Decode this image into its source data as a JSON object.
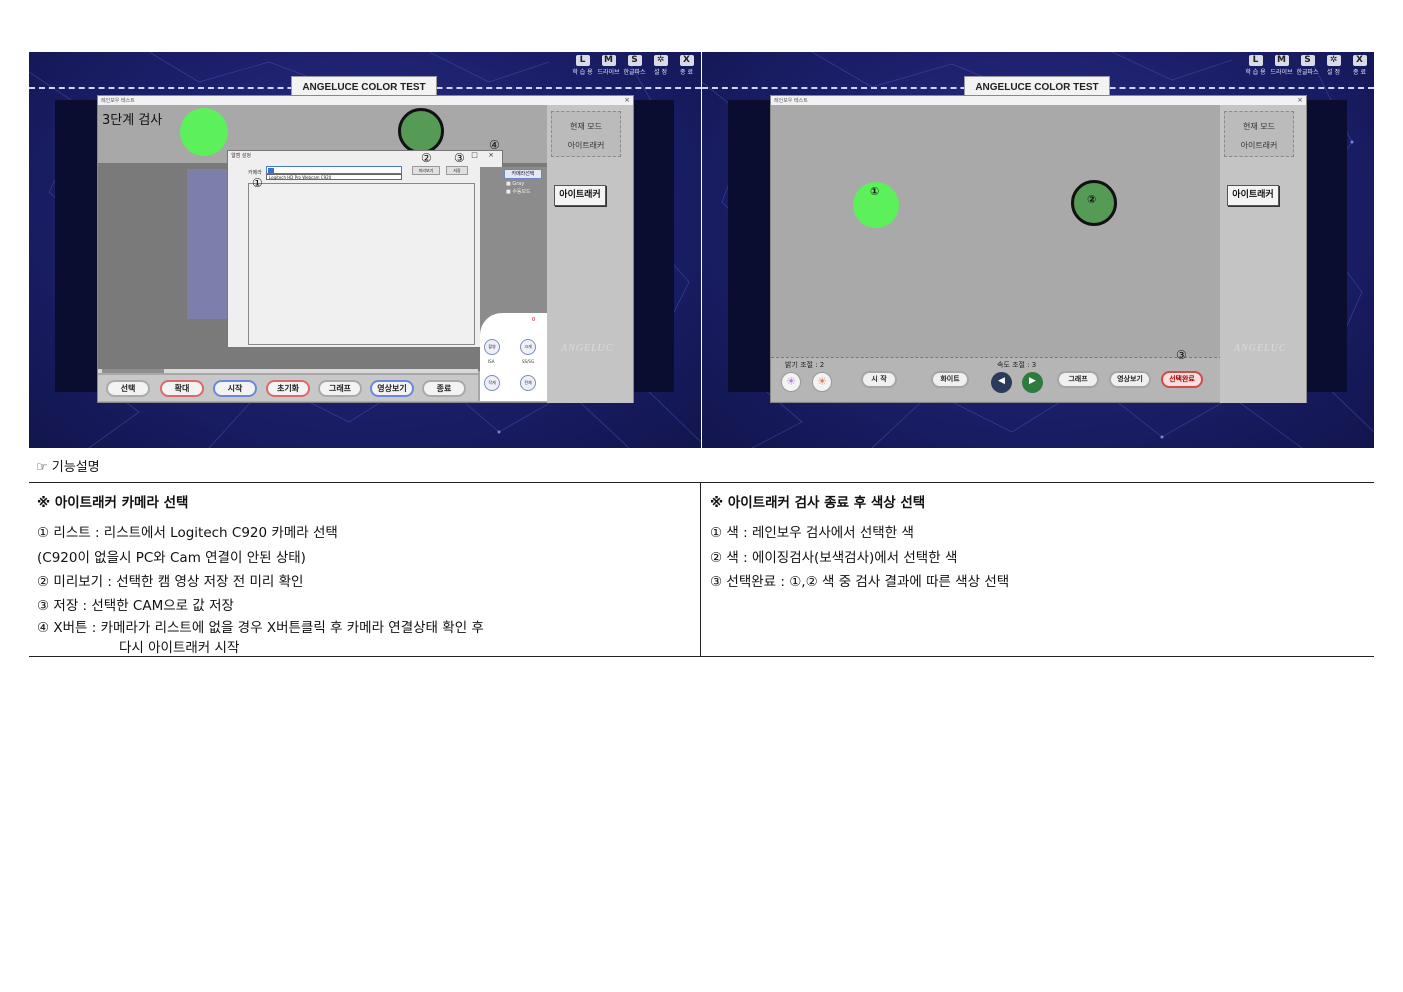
{
  "left_shot": {
    "app_title": "ANGELUCE COLOR TEST",
    "top_icons": [
      {
        "glyph": "L",
        "label": "학 습 용"
      },
      {
        "glyph": "M",
        "label": "드라이브"
      },
      {
        "glyph": "S",
        "label": "한글파스"
      },
      {
        "glyph": "✲",
        "label": "설 정"
      },
      {
        "glyph": "X",
        "label": "종 료"
      }
    ],
    "window_title": "레인보우 테스트",
    "window_close": "×",
    "stage_label": "3단계 검사",
    "side_mode": [
      "현재 모드",
      "아이트래커"
    ],
    "side_button": "아이트래커",
    "logo_text": "ANGELUC",
    "dialog": {
      "title": "웹캠 설정",
      "controls": "□ ×",
      "camera_label": "카메라",
      "select_value": "",
      "dropdown_item": "Logitech HD Pro Webcam C920",
      "preview_button": "미리보기",
      "save_button": "저장"
    },
    "markers": [
      "①",
      "②",
      "③",
      "④"
    ],
    "panel": {
      "button": "카메라선택",
      "options": [
        "Gray",
        "수동모드"
      ],
      "zero": "0",
      "round_buttons": [
        "촬영",
        "크게",
        "작게",
        "전체"
      ],
      "round_labels": [
        "ISA",
        "SS/SG"
      ]
    },
    "bottom_buttons": [
      "선택",
      "확대",
      "시작",
      "초기화",
      "그래프",
      "영상보기",
      "종료"
    ],
    "colors": {
      "green_bright": "#5cf05a",
      "green_dark": "#559b55",
      "pill_red": "#d96a6a",
      "pill_blue": "#6a8ad9"
    }
  },
  "right_shot": {
    "app_title": "ANGELUCE COLOR TEST",
    "top_icons": [
      {
        "glyph": "L",
        "label": "학 습 용"
      },
      {
        "glyph": "M",
        "label": "드라이브"
      },
      {
        "glyph": "S",
        "label": "한글파스"
      },
      {
        "glyph": "✲",
        "label": "설 정"
      },
      {
        "glyph": "X",
        "label": "종 료"
      }
    ],
    "window_title": "레인보우 테스트",
    "window_close": "×",
    "side_mode": [
      "현재 모드",
      "아이트래커"
    ],
    "side_button": "아이트래커",
    "logo_text": "ANGELUC",
    "circle_marks": [
      "①",
      "②"
    ],
    "done_mark": "③",
    "brightness_label": "밝기 조절 : 2",
    "speed_label": "속도 조절 : 3",
    "buttons": {
      "start": "시 작",
      "white": "화이트",
      "graph": "그래프",
      "video": "영상보기",
      "done": "선택완료"
    }
  },
  "description": {
    "title": "☞ 기능설명",
    "left": {
      "heading": "※ 아이트래커 카메라 선택",
      "lines": [
        "① 리스트 : 리스트에서 Logitech C920 카메라 선택",
        "(C920이 없을시 PC와 Cam 연결이 안된 상태)",
        "② 미리보기 : 선택한 캠 영상 저장 전 미리 확인",
        "③ 저장 : 선택한 CAM으로 값 저장",
        "④ X버튼 : 카메라가 리스트에 없을 경우 X버튼클릭 후 카메라 연결상태 확인 후",
        "다시 아이트래커 시작"
      ]
    },
    "right": {
      "heading": "※ 아이트래커 검사 종료 후 색상 선택",
      "lines": [
        "① 색 : 레인보우 검사에서 선택한 색",
        "② 색 : 에이징검사(보색검사)에서 선택한 색",
        "③ 선택완료 : ①,② 색 중 검사 결과에 따른 색상 선택"
      ]
    }
  }
}
